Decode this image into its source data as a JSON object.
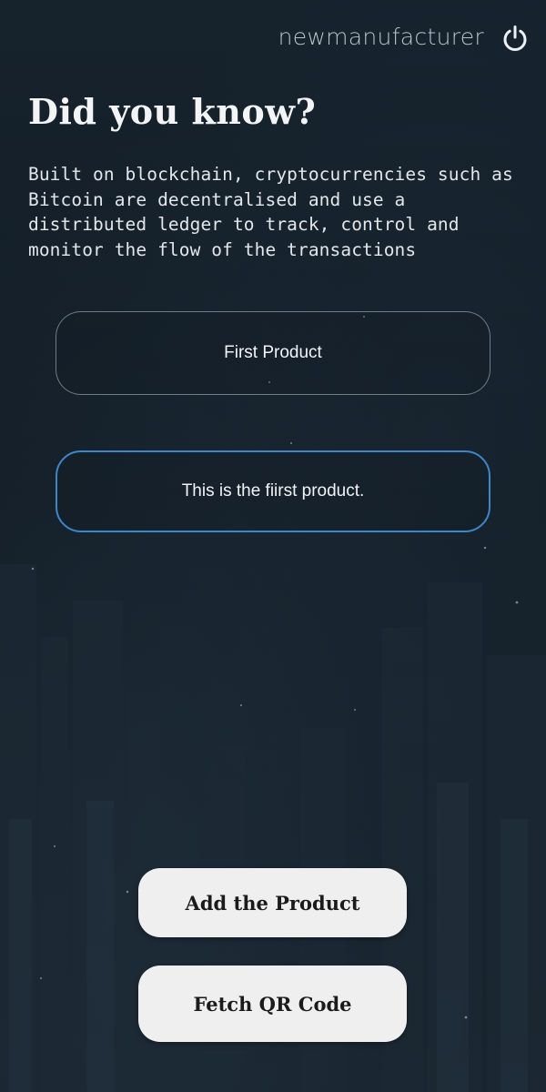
{
  "header": {
    "username": "newmanufacturer",
    "power_icon": "power-icon"
  },
  "info": {
    "heading": "Did you know?",
    "fact": "Built on blockchain, cryptocurrencies such as Bitcoin are decentralised and use a distributed ledger to track, control and monitor the flow of the transactions"
  },
  "form": {
    "product_name_value": "First Product",
    "product_description_value": "This is the fiirst product."
  },
  "actions": {
    "add_label": "Add the Product",
    "fetch_qr_label": "Fetch QR Code"
  },
  "colors": {
    "background": "#141e27",
    "focus_border": "#3f86c8",
    "button_bg": "#efefef"
  }
}
